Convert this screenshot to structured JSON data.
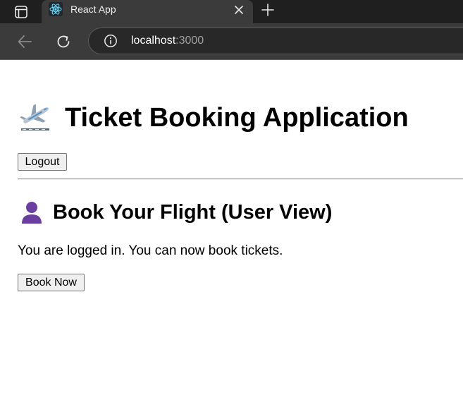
{
  "browser": {
    "window_icon": "sidebar-window-icon",
    "tab": {
      "title": "React App",
      "favicon": "react-icon",
      "close_icon": "close-icon"
    },
    "new_tab_icon": "plus-icon",
    "toolbar": {
      "back_icon": "arrow-left-icon",
      "reload_icon": "reload-icon",
      "info_icon": "info-icon",
      "url_host": "localhost",
      "url_port": ":3000"
    }
  },
  "app": {
    "title": "Ticket Booking Application",
    "title_icon": "airplane-departure-icon",
    "logout_label": "Logout",
    "section_title": "Book Your Flight (User View)",
    "section_icon": "user-silhouette-icon",
    "message": "You are logged in. You can now book tickets.",
    "book_label": "Book Now"
  },
  "colors": {
    "chrome_dark": "#1f1f1f",
    "chrome_tab": "#3b3b3b",
    "address_bg": "#282828",
    "react_blue": "#61dafb",
    "user_purple": "#6b3fa0"
  }
}
